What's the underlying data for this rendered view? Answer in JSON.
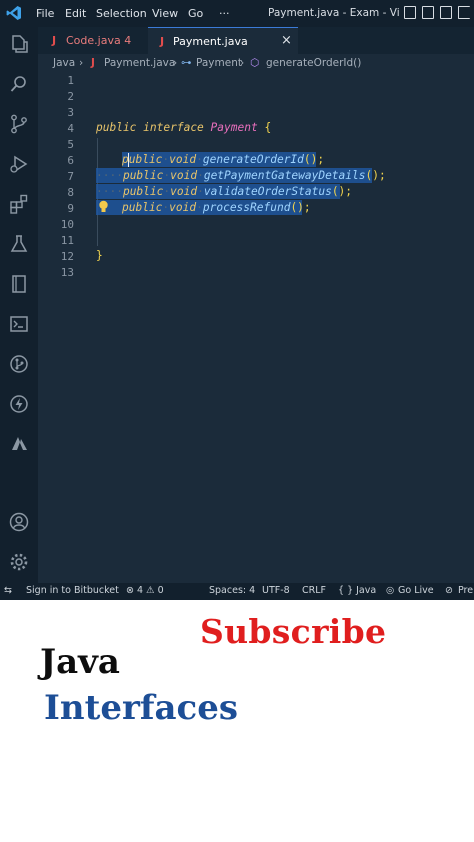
{
  "titlebar": {
    "menu": [
      "File",
      "Edit",
      "Selection",
      "View",
      "Go",
      "···"
    ],
    "window_title": "Payment.java - Exam - Visua..."
  },
  "tabs": [
    {
      "prefix": "J",
      "label": "Code.java 4"
    },
    {
      "prefix": "J",
      "label": "Payment.java",
      "close": "×"
    }
  ],
  "breadcrumb": {
    "root": "Java",
    "file_prefix": "J",
    "file": "Payment.java",
    "interface": "Payment",
    "method": "generateOrderId()"
  },
  "editor": {
    "line_numbers": [
      "1",
      "2",
      "3",
      "4",
      "5",
      "6",
      "7",
      "8",
      "9",
      "10",
      "11",
      "12",
      "13"
    ],
    "line4": {
      "kw1": "public",
      "kw2": "interface",
      "type": "Payment",
      "brace": "{"
    },
    "methods": [
      {
        "kw": "public",
        "kw2": "void",
        "name": "generateOrderId",
        "paren": "();"
      },
      {
        "kw": "public",
        "kw2": "void",
        "name": "getPaymentGatewayDetails",
        "paren": "();"
      },
      {
        "kw": "public",
        "kw2": "void",
        "name": "validateOrderStatus",
        "paren": "();"
      },
      {
        "kw": "public",
        "kw2": "void",
        "name": "processRefund",
        "paren": "();"
      }
    ],
    "closing_brace": "}"
  },
  "statusbar": {
    "bitbucket": "Sign in to Bitbucket",
    "problems": "⊗ 4 ⚠ 0",
    "spaces": "Spaces: 4",
    "encoding": "UTF-8",
    "eol": "CRLF",
    "language": "{ } Java",
    "golive": "Go Live",
    "pre": "Pre"
  },
  "overlay": {
    "subscribe": "Subscribe",
    "title_line1": "Java",
    "title_line2": "Interfaces"
  },
  "colors": {
    "accent_red": "#e01e1e",
    "interfaces_blue": "#1d4e96",
    "editor_bg": "#1b2b3a",
    "selection": "#1f5aa6"
  }
}
